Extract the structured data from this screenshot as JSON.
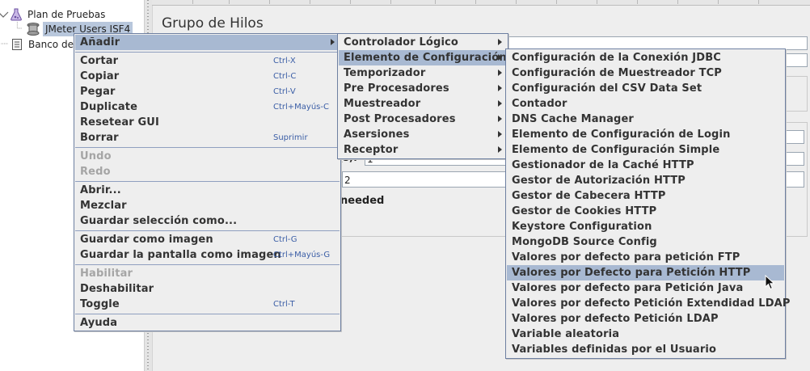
{
  "tree": {
    "items": [
      {
        "label": "Plan de Pruebas",
        "icon": "test-plan-icon"
      },
      {
        "label": "JMeter Users ISF4",
        "icon": "thread-group-icon"
      },
      {
        "label": "Banco de",
        "icon": "workbench-icon"
      }
    ]
  },
  "panel": {
    "title": "Grupo de Hilos",
    "field_ramp_label": "(s):",
    "field_ramp_value": "1",
    "field_loop_value": "2",
    "delay_text": "needed"
  },
  "context_menu": {
    "items": [
      {
        "label": "Añadir",
        "submenu": true
      },
      {
        "label": "Cortar",
        "shortcut": "Ctrl-X"
      },
      {
        "label": "Copiar",
        "shortcut": "Ctrl-C"
      },
      {
        "label": "Pegar",
        "shortcut": "Ctrl-V"
      },
      {
        "label": "Duplicate",
        "shortcut": "Ctrl+Mayús-C"
      },
      {
        "label": "Resetear GUI"
      },
      {
        "label": "Borrar",
        "shortcut": "Suprimir"
      },
      {
        "label": "Undo",
        "disabled": true
      },
      {
        "label": "Redo",
        "disabled": true
      },
      {
        "label": "Abrir..."
      },
      {
        "label": "Mezclar"
      },
      {
        "label": "Guardar selección como..."
      },
      {
        "label": "Guardar como imagen",
        "shortcut": "Ctrl-G"
      },
      {
        "label": "Guardar la pantalla como imagen",
        "shortcut": "Ctrl+Mayús-G"
      },
      {
        "label": "Habilitar",
        "disabled": true
      },
      {
        "label": "Deshabilitar"
      },
      {
        "label": "Toggle",
        "shortcut": "Ctrl-T"
      },
      {
        "label": "Ayuda"
      }
    ]
  },
  "add_submenu": {
    "items": [
      {
        "label": "Controlador Lógico"
      },
      {
        "label": "Elemento de Configuración"
      },
      {
        "label": "Temporizador"
      },
      {
        "label": "Pre Procesadores"
      },
      {
        "label": "Muestreador"
      },
      {
        "label": "Post Procesadores"
      },
      {
        "label": "Asersiones"
      },
      {
        "label": "Receptor"
      }
    ]
  },
  "config_submenu": {
    "items": [
      {
        "label": "Configuración de la Conexión JDBC"
      },
      {
        "label": "Configuración de Muestreador TCP"
      },
      {
        "label": "Configuración del CSV Data Set"
      },
      {
        "label": "Contador"
      },
      {
        "label": "DNS Cache Manager"
      },
      {
        "label": "Elemento de Configuración de Login"
      },
      {
        "label": "Elemento de Configuración Simple"
      },
      {
        "label": "Gestionador de la Caché HTTP"
      },
      {
        "label": "Gestor de Autorización HTTP"
      },
      {
        "label": "Gestor de Cabecera HTTP"
      },
      {
        "label": "Gestor de Cookies HTTP"
      },
      {
        "label": "Keystore Configuration"
      },
      {
        "label": "MongoDB Source Config"
      },
      {
        "label": "Valores por defecto para petición FTP"
      },
      {
        "label": "Valores por Defecto para Petición HTTP"
      },
      {
        "label": "Valores por defecto para Petición Java"
      },
      {
        "label": "Valores por defecto Petición Extendidad LDAP"
      },
      {
        "label": "Valores por defecto Petición LDAP"
      },
      {
        "label": "Variable aleatoria"
      },
      {
        "label": "Variables definidas por el Usuario"
      }
    ]
  },
  "colors": {
    "menu_bg": "#eeeeee",
    "selection": "#a8b9d2",
    "menu_border": "#6d7fa1",
    "shortcut": "#3b5ea6",
    "disabled": "#a5a5a5"
  }
}
